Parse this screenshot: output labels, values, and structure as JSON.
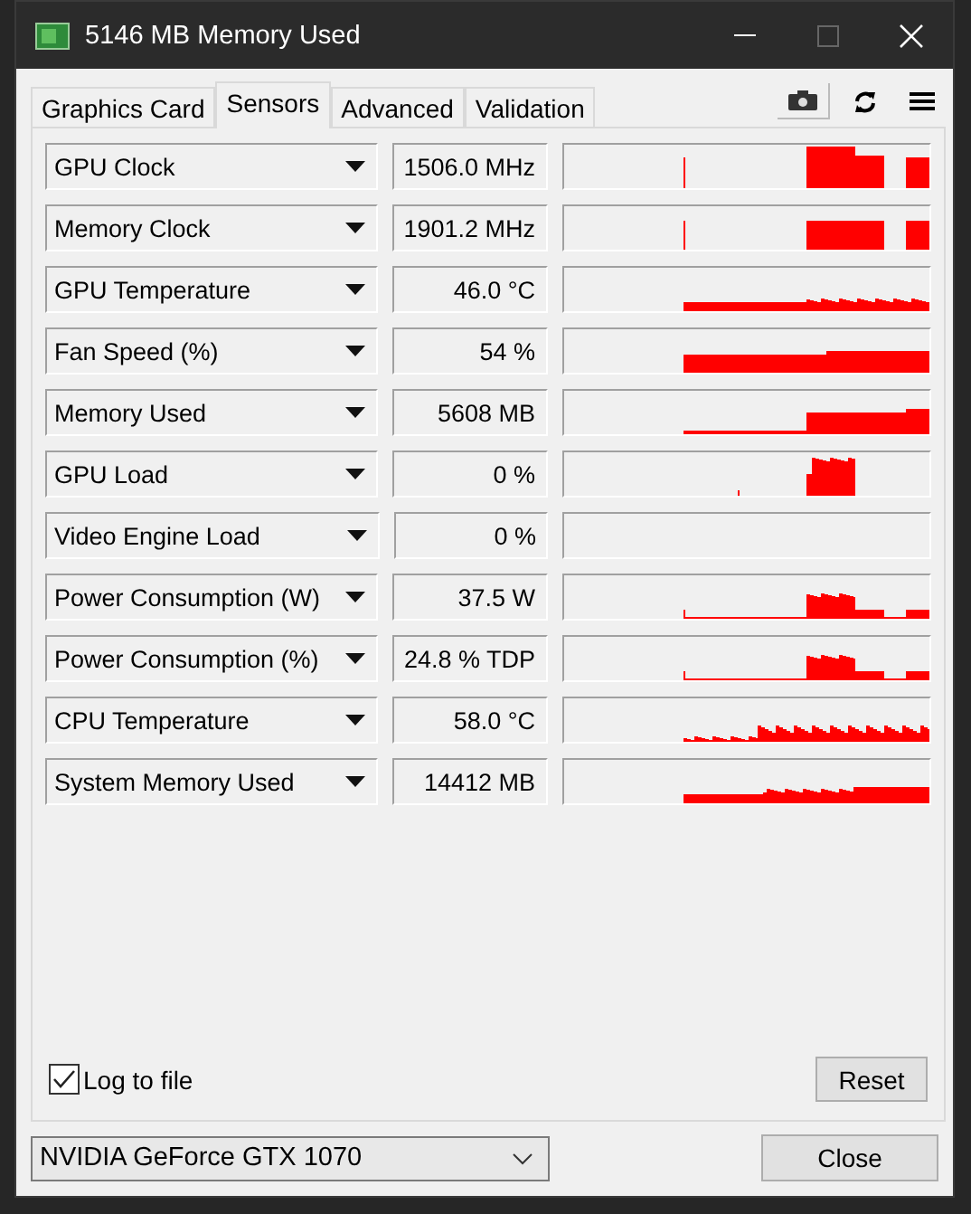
{
  "window": {
    "title": "5146 MB Memory Used"
  },
  "tabs": [
    {
      "label": "Graphics Card",
      "selected": false
    },
    {
      "label": "Sensors",
      "selected": true
    },
    {
      "label": "Advanced",
      "selected": false
    },
    {
      "label": "Validation",
      "selected": false
    }
  ],
  "sensors": [
    {
      "name": "GPU Clock",
      "value": "1506.0 MHz"
    },
    {
      "name": "Memory Clock",
      "value": "1901.2 MHz"
    },
    {
      "name": "GPU Temperature",
      "value": "46.0 °C"
    },
    {
      "name": "Fan Speed (%)",
      "value": "54 %"
    },
    {
      "name": "Memory Used",
      "value": "5608 MB"
    },
    {
      "name": "GPU Load",
      "value": "0 %"
    },
    {
      "name": "Video Engine Load",
      "value": "0 %"
    },
    {
      "name": "Power Consumption (W)",
      "value": "37.5 W"
    },
    {
      "name": "Power Consumption (%)",
      "value": "24.8 % TDP"
    },
    {
      "name": "CPU Temperature",
      "value": "58.0 °C"
    },
    {
      "name": "System Memory Used",
      "value": "14412 MB"
    }
  ],
  "log_to_file": {
    "label": "Log to file",
    "checked": true
  },
  "reset_button": "Reset",
  "gpu_select": {
    "value": "NVIDIA GeForce GTX 1070"
  },
  "close_button": "Close"
}
